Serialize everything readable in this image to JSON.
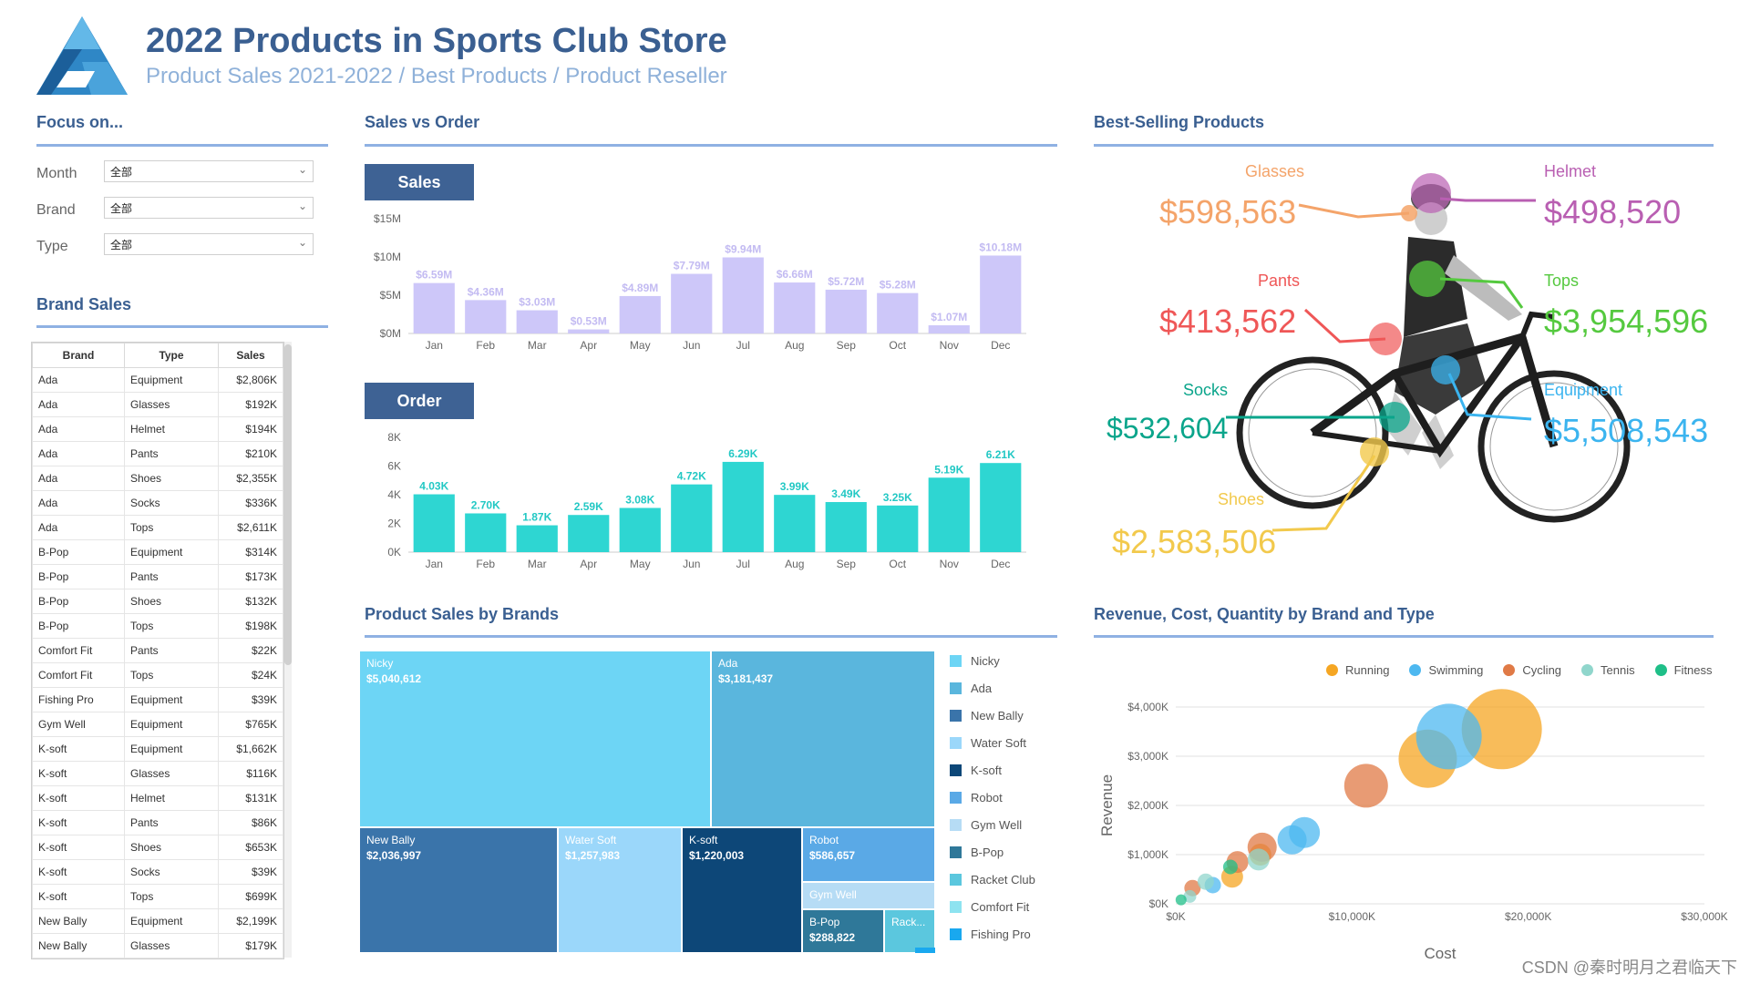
{
  "header": {
    "title": "2022 Products in Sports Club Store",
    "subtitle": "Product Sales 2021-2022 / Best Products / Product Reseller"
  },
  "colors": {
    "accent": "#3a5f91",
    "sales_bar": "#cdc7f9",
    "order_bar": "#2ed6d2"
  },
  "focus": {
    "heading": "Focus on...",
    "filters": [
      {
        "label": "Month",
        "value": "全部"
      },
      {
        "label": "Brand",
        "value": "全部"
      },
      {
        "label": "Type",
        "value": "全部"
      }
    ]
  },
  "brand_sales": {
    "heading": "Brand Sales",
    "columns": [
      "Brand",
      "Type",
      "Sales"
    ],
    "rows": [
      [
        "Ada",
        "Equipment",
        "$2,806K"
      ],
      [
        "Ada",
        "Glasses",
        "$192K"
      ],
      [
        "Ada",
        "Helmet",
        "$194K"
      ],
      [
        "Ada",
        "Pants",
        "$210K"
      ],
      [
        "Ada",
        "Shoes",
        "$2,355K"
      ],
      [
        "Ada",
        "Socks",
        "$336K"
      ],
      [
        "Ada",
        "Tops",
        "$2,611K"
      ],
      [
        "B-Pop",
        "Equipment",
        "$314K"
      ],
      [
        "B-Pop",
        "Pants",
        "$173K"
      ],
      [
        "B-Pop",
        "Shoes",
        "$132K"
      ],
      [
        "B-Pop",
        "Tops",
        "$198K"
      ],
      [
        "Comfort Fit",
        "Pants",
        "$22K"
      ],
      [
        "Comfort Fit",
        "Tops",
        "$24K"
      ],
      [
        "Fishing Pro",
        "Equipment",
        "$39K"
      ],
      [
        "Gym Well",
        "Equipment",
        "$765K"
      ],
      [
        "K-soft",
        "Equipment",
        "$1,662K"
      ],
      [
        "K-soft",
        "Glasses",
        "$116K"
      ],
      [
        "K-soft",
        "Helmet",
        "$131K"
      ],
      [
        "K-soft",
        "Pants",
        "$86K"
      ],
      [
        "K-soft",
        "Shoes",
        "$653K"
      ],
      [
        "K-soft",
        "Socks",
        "$39K"
      ],
      [
        "K-soft",
        "Tops",
        "$699K"
      ],
      [
        "New Bally",
        "Equipment",
        "$2,199K"
      ],
      [
        "New Bally",
        "Glasses",
        "$179K"
      ]
    ]
  },
  "sales_vs_order": {
    "heading": "Sales vs Order",
    "sales_tab": "Sales",
    "order_tab": "Order"
  },
  "chart_data": [
    {
      "type": "bar",
      "title": "Sales",
      "categories": [
        "Jan",
        "Feb",
        "Mar",
        "Apr",
        "May",
        "Jun",
        "Jul",
        "Aug",
        "Sep",
        "Oct",
        "Nov",
        "Dec"
      ],
      "values": [
        6.59,
        4.36,
        3.03,
        0.53,
        4.89,
        7.79,
        9.94,
        6.66,
        5.72,
        5.28,
        1.07,
        10.18
      ],
      "labels": [
        "$6.59M",
        "$4.36M",
        "$3.03M",
        "$0.53M",
        "$4.89M",
        "$7.79M",
        "$9.94M",
        "$6.66M",
        "$5.72M",
        "$5.28M",
        "$1.07M",
        "$10.18M"
      ],
      "yticks": [
        "$0M",
        "$5M",
        "$10M",
        "$15M"
      ],
      "ylim": [
        0,
        15
      ]
    },
    {
      "type": "bar",
      "title": "Order",
      "categories": [
        "Jan",
        "Feb",
        "Mar",
        "Apr",
        "May",
        "Jun",
        "Jul",
        "Aug",
        "Sep",
        "Oct",
        "Nov",
        "Dec"
      ],
      "values": [
        4.03,
        2.7,
        1.87,
        2.59,
        3.08,
        4.72,
        6.29,
        3.99,
        3.49,
        3.25,
        5.19,
        6.21
      ],
      "labels": [
        "4.03K",
        "2.70K",
        "1.87K",
        "2.59K",
        "3.08K",
        "4.72K",
        "6.29K",
        "3.99K",
        "3.49K",
        "3.25K",
        "5.19K",
        "6.21K"
      ],
      "yticks": [
        "0K",
        "2K",
        "4K",
        "6K",
        "8K"
      ],
      "ylim": [
        0,
        8
      ]
    },
    {
      "type": "scatter",
      "title": "Revenue, Cost, Quantity by Brand and Type",
      "xlabel": "Cost",
      "ylabel": "Revenue",
      "xlim": [
        0,
        30000
      ],
      "ylim": [
        0,
        4000
      ],
      "xticks": [
        "$0K",
        "$10,000K",
        "$20,000K",
        "$30,000K"
      ],
      "yticks": [
        "$0K",
        "$1,000K",
        "$2,000K",
        "$3,000K",
        "$4,000K"
      ],
      "legend": "top-right",
      "series": [
        {
          "name": "Running",
          "color": "#f5a623",
          "points": [
            [
              18500,
              3550,
              44
            ],
            [
              14300,
              2950,
              32
            ],
            [
              3200,
              550,
              12
            ],
            [
              4800,
              1000,
              12
            ]
          ]
        },
        {
          "name": "Swimming",
          "color": "#4db8f0",
          "points": [
            [
              15500,
              3400,
              36
            ],
            [
              7300,
              1450,
              17
            ],
            [
              6600,
              1300,
              16
            ],
            [
              2100,
              380,
              9
            ]
          ]
        },
        {
          "name": "Cycling",
          "color": "#e07a46",
          "points": [
            [
              10800,
              2400,
              24
            ],
            [
              4900,
              1150,
              16
            ],
            [
              950,
              320,
              9
            ],
            [
              3500,
              850,
              12
            ]
          ]
        },
        {
          "name": "Tennis",
          "color": "#90d6cc",
          "points": [
            [
              4700,
              900,
              12
            ],
            [
              1700,
              450,
              9
            ],
            [
              800,
              150,
              7
            ]
          ]
        },
        {
          "name": "Fitness",
          "color": "#1fbf88",
          "points": [
            [
              3100,
              750,
              8
            ],
            [
              300,
              80,
              6
            ]
          ]
        }
      ]
    }
  ],
  "best_selling": {
    "heading": "Best-Selling Products",
    "items": [
      {
        "name": "Glasses",
        "value": "$598,563",
        "color": "#f4a46a"
      },
      {
        "name": "Helmet",
        "value": "$498,520",
        "color": "#b95fb2"
      },
      {
        "name": "Pants",
        "value": "$413,562",
        "color": "#ef5757"
      },
      {
        "name": "Tops",
        "value": "$3,954,596",
        "color": "#55c93f"
      },
      {
        "name": "Socks",
        "value": "$532,604",
        "color": "#0aa58b"
      },
      {
        "name": "Equipment",
        "value": "$5,508,543",
        "color": "#3bb4ef"
      },
      {
        "name": "Shoes",
        "value": "$2,583,506",
        "color": "#f2c94c"
      }
    ]
  },
  "product_sales_by_brands": {
    "heading": "Product Sales by Brands",
    "cells": [
      {
        "name": "Nicky",
        "value": "$5,040,612",
        "color": "#6dd5f5"
      },
      {
        "name": "Ada",
        "value": "$3,181,437",
        "color": "#5ab6dd"
      },
      {
        "name": "New Bally",
        "value": "$2,036,997",
        "color": "#3a74aa"
      },
      {
        "name": "Water Soft",
        "value": "$1,257,983",
        "color": "#9bd7fa"
      },
      {
        "name": "K-soft",
        "value": "$1,220,003",
        "color": "#0d4778"
      },
      {
        "name": "Robot",
        "value": "$586,657",
        "color": "#5aa9e6"
      },
      {
        "name": "Gym Well",
        "value": "",
        "color": "#b6dcf5"
      },
      {
        "name": "B-Pop",
        "value": "$288,822",
        "color": "#2f7899"
      },
      {
        "name": "Rack...",
        "value": "",
        "color": "#5bc7de"
      }
    ],
    "legend": [
      {
        "name": "Nicky",
        "color": "#6dd5f5"
      },
      {
        "name": "Ada",
        "color": "#5ab6dd"
      },
      {
        "name": "New Bally",
        "color": "#3a74aa"
      },
      {
        "name": "Water Soft",
        "color": "#9bd7fa"
      },
      {
        "name": "K-soft",
        "color": "#0d4778"
      },
      {
        "name": "Robot",
        "color": "#5aa9e6"
      },
      {
        "name": "Gym Well",
        "color": "#b6dcf5"
      },
      {
        "name": "B-Pop",
        "color": "#2f7899"
      },
      {
        "name": "Racket Club",
        "color": "#5bc7de"
      },
      {
        "name": "Comfort Fit",
        "color": "#8ee3f0"
      },
      {
        "name": "Fishing Pro",
        "color": "#19a8ef"
      }
    ]
  },
  "scatter": {
    "heading": "Revenue, Cost, Quantity by Brand and Type"
  },
  "watermark": "CSDN @秦时明月之君临天下"
}
